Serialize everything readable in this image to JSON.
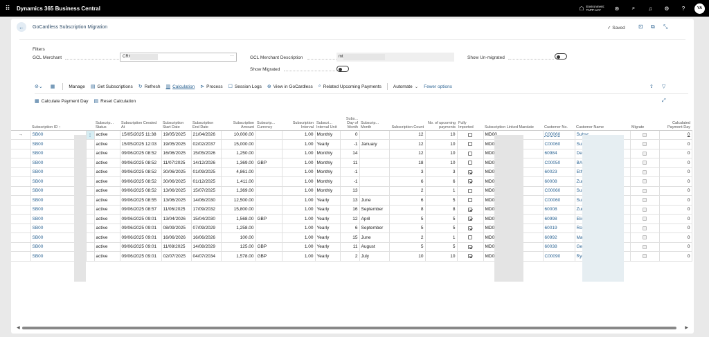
{
  "app": {
    "title": "Dynamics 365 Business Central",
    "env_label": "Environment:",
    "env_name": "TAPP-UAT",
    "avatar": "YA"
  },
  "page": {
    "title": "GoCardless Subscription Migration",
    "saved": "Saved"
  },
  "filters": {
    "heading": "Filters",
    "merchant_label": "GCL Merchant",
    "merchant_value": "CRX",
    "merchant_desc_label": "GCL Merchant Description",
    "merchant_desc_value": "mt",
    "show_unmigrated_label": "Show Un-migrated",
    "show_migrated_label": "Show Migrated"
  },
  "actions": {
    "manage": "Manage",
    "get_subscriptions": "Get Subscriptions",
    "refresh": "Refresh",
    "calculation": "Calculation",
    "process": "Process",
    "session_logs": "Session Logs",
    "view_in_gocardless": "View in GoCardless",
    "related_upcoming_payments": "Related Upcoming Payments",
    "automate": "Automate",
    "fewer_options": "Fewer options",
    "calculate_payment_day": "Calculate Payment Day",
    "reset_calculation": "Reset Calculation"
  },
  "columns": [
    "Subscription ID ↑",
    "Subscrip... Status",
    "Subscription Created At",
    "Subscription Start Date",
    "Subscription End Date",
    "Subscription Amount",
    "Subscrip... Currency",
    "Subscription Interval",
    "Subscri... Interval Unit",
    "Subs... Day of Month",
    "Subscrip... Month",
    "Subscription Count",
    "No. of upcoming payments",
    "Fully Imported",
    "Subscription Linked Mandate",
    "Customer No.",
    "Customer Name",
    "Migrate",
    "Calculated Payment Day"
  ],
  "rows": [
    {
      "id": "SB00",
      "status": "active",
      "created": "15/05/2025 11:38",
      "start": "19/05/2025",
      "end": "21/04/2026",
      "amount": "10,000.00",
      "currency": "",
      "interval": "1.00",
      "unit": "Monthly",
      "dom": "0",
      "month": "",
      "count": "12",
      "upcoming": "10",
      "imported": false,
      "mandate": "MD00",
      "custno": "C00060",
      "custname": "Subsc",
      "payday": "0"
    },
    {
      "id": "SB00",
      "status": "active",
      "created": "15/05/2025 12:03",
      "start": "19/05/2025",
      "end": "02/02/2037",
      "amount": "15,000.00",
      "currency": "",
      "interval": "1.00",
      "unit": "Yearly",
      "dom": "-1",
      "month": "January",
      "count": "12",
      "upcoming": "10",
      "imported": false,
      "mandate": "MD00",
      "custno": "C00060",
      "custname": "Subsc",
      "payday": "0"
    },
    {
      "id": "SB00",
      "status": "active",
      "created": "09/06/2025 08:52",
      "start": "16/06/2025",
      "end": "15/05/2026",
      "amount": "1,250.00",
      "currency": "",
      "interval": "1.00",
      "unit": "Monthly",
      "dom": "14",
      "month": "",
      "count": "12",
      "upcoming": "10",
      "imported": false,
      "mandate": "MD00",
      "custno": "60984",
      "custname": "Denis",
      "payday": "0"
    },
    {
      "id": "SB00",
      "status": "active",
      "created": "09/06/2025 08:52",
      "start": "11/07/2025",
      "end": "14/12/2026",
      "amount": "1,369.00",
      "currency": "GBP",
      "interval": "1.00",
      "unit": "Monthly",
      "dom": "11",
      "month": "",
      "count": "18",
      "upcoming": "10",
      "imported": false,
      "mandate": "MD00",
      "custno": "C00050",
      "custname": "BACS",
      "payday": "0"
    },
    {
      "id": "SB00",
      "status": "active",
      "created": "09/06/2025 08:52",
      "start": "30/06/2025",
      "end": "01/09/2025",
      "amount": "4,861.00",
      "currency": "",
      "interval": "1.00",
      "unit": "Monthly",
      "dom": "-1",
      "month": "",
      "count": "3",
      "upcoming": "3",
      "imported": true,
      "mandate": "MD00",
      "custno": "60023",
      "custname": "Ethan",
      "payday": "0"
    },
    {
      "id": "SB00",
      "status": "active",
      "created": "09/06/2025 08:52",
      "start": "30/06/2025",
      "end": "01/12/2025",
      "amount": "1,411.00",
      "currency": "",
      "interval": "1.00",
      "unit": "Monthly",
      "dom": "-1",
      "month": "",
      "count": "6",
      "upcoming": "6",
      "imported": true,
      "mandate": "MD00",
      "custno": "60008",
      "custname": "Zuri C",
      "payday": "0"
    },
    {
      "id": "SB00",
      "status": "active",
      "created": "09/06/2025 08:52",
      "start": "13/06/2025",
      "end": "15/07/2025",
      "amount": "1,369.00",
      "currency": "",
      "interval": "1.00",
      "unit": "Monthly",
      "dom": "13",
      "month": "",
      "count": "2",
      "upcoming": "1",
      "imported": false,
      "mandate": "MD00",
      "custno": "C00060",
      "custname": "Subsc",
      "payday": "0"
    },
    {
      "id": "SB00",
      "status": "active",
      "created": "09/06/2025 08:55",
      "start": "13/06/2025",
      "end": "14/06/2030",
      "amount": "12,500.00",
      "currency": "",
      "interval": "1.00",
      "unit": "Yearly",
      "dom": "13",
      "month": "June",
      "count": "6",
      "upcoming": "5",
      "imported": false,
      "mandate": "MD00",
      "custno": "C00060",
      "custname": "Subsc",
      "payday": "0"
    },
    {
      "id": "SB00",
      "status": "active",
      "created": "09/06/2025 08:57",
      "start": "11/06/2025",
      "end": "17/09/2032",
      "amount": "15,800.00",
      "currency": "",
      "interval": "1.00",
      "unit": "Yearly",
      "dom": "16",
      "month": "September",
      "count": "8",
      "upcoming": "8",
      "imported": true,
      "mandate": "MD00",
      "custno": "60008",
      "custname": "Zuri C",
      "payday": "0"
    },
    {
      "id": "SB00",
      "status": "active",
      "created": "09/06/2025 09:01",
      "start": "13/04/2026",
      "end": "15/04/2030",
      "amount": "1,568.00",
      "currency": "GBP",
      "interval": "1.00",
      "unit": "Yearly",
      "dom": "12",
      "month": "April",
      "count": "5",
      "upcoming": "5",
      "imported": true,
      "mandate": "MD00",
      "custno": "60998",
      "custname": "Elisa I",
      "payday": "0"
    },
    {
      "id": "SB00",
      "status": "active",
      "created": "09/06/2025 09:01",
      "start": "08/09/2025",
      "end": "07/09/2029",
      "amount": "1,258.00",
      "currency": "",
      "interval": "1.00",
      "unit": "Yearly",
      "dom": "6",
      "month": "September",
      "count": "5",
      "upcoming": "5",
      "imported": true,
      "mandate": "MD00",
      "custno": "60019",
      "custname": "Rome",
      "payday": "0"
    },
    {
      "id": "SB00",
      "status": "active",
      "created": "09/06/2025 09:01",
      "start": "16/06/2026",
      "end": "16/06/2026",
      "amount": "100.00",
      "currency": "",
      "interval": "1.00",
      "unit": "Yearly",
      "dom": "15",
      "month": "June",
      "count": "2",
      "upcoming": "1",
      "imported": false,
      "mandate": "MD00",
      "custno": "60992",
      "custname": "Maci",
      "payday": "0"
    },
    {
      "id": "SB00",
      "status": "active",
      "created": "09/06/2025 09:01",
      "start": "11/08/2025",
      "end": "14/08/2029",
      "amount": "125.00",
      "currency": "GBP",
      "interval": "1.00",
      "unit": "Yearly",
      "dom": "11",
      "month": "August",
      "count": "5",
      "upcoming": "5",
      "imported": true,
      "mandate": "MD00",
      "custno": "60038",
      "custname": "Genev",
      "payday": "0"
    },
    {
      "id": "SB00",
      "status": "active",
      "created": "09/06/2025 09:01",
      "start": "02/07/2025",
      "end": "04/07/2034",
      "amount": "1,578.00",
      "currency": "GBP",
      "interval": "1.00",
      "unit": "Yearly",
      "dom": "2",
      "month": "July",
      "count": "10",
      "upcoming": "10",
      "imported": true,
      "mandate": "MD00",
      "custno": "C00090",
      "custname": "Ryder",
      "payday": "0"
    }
  ]
}
